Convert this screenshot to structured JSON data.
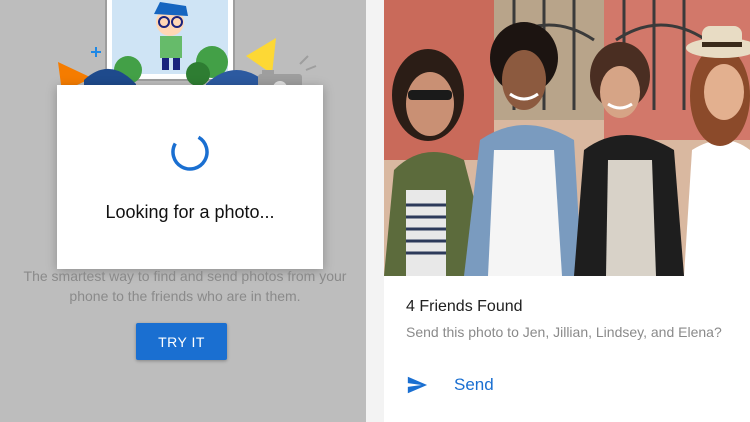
{
  "left": {
    "dialog_text": "Looking for a photo...",
    "tagline": "The smartest way to find and send photos from your phone to the friends who are in them.",
    "try_button": "TRY IT",
    "spinner_icon": "loading-spinner-icon"
  },
  "right": {
    "found_title": "4 Friends Found",
    "found_subtitle": "Send this photo to Jen, Jillian, Lindsey, and Elena?",
    "send_label": "Send",
    "send_icon": "send-icon"
  },
  "colors": {
    "accent": "#1a6fd1",
    "left_bg": "#bdbdbd",
    "text_secondary": "#8a8a8a"
  }
}
